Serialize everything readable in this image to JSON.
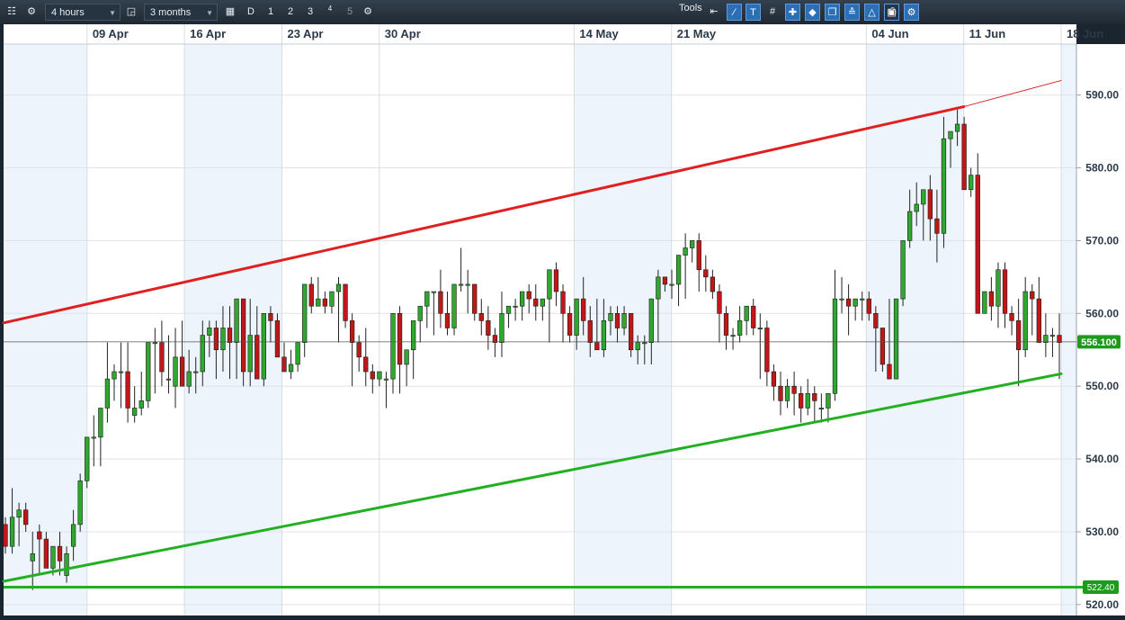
{
  "toolbar": {
    "interval": "4 hours",
    "period": "3 months",
    "period_buttons": [
      "D",
      "1",
      "2",
      "3",
      "4",
      "5"
    ],
    "tools_label": "Tools",
    "icons": [
      "menu-icon",
      "settings-icon",
      "lock-icon",
      "calendar-icon",
      "chart-settings-icon",
      "arrow-back-icon",
      "line-tool-icon",
      "text-tool-icon",
      "grid-icon",
      "crosshair-icon",
      "marker-icon",
      "copy-icon",
      "indicator-icon",
      "shape-icon",
      "fullscreen-icon",
      "print-icon",
      "settings-tools-icon"
    ]
  },
  "chart_data": {
    "type": "candlestick",
    "x_tick_labels": [
      "09 Apr",
      "16 Apr",
      "23 Apr",
      "30 Apr",
      "14 May",
      "21 May",
      "04 Jun",
      "11 Jun",
      "18 Jun"
    ],
    "y_tick_labels": [
      "590.00",
      "580.00",
      "570.00",
      "560.00",
      "550.00",
      "540.00",
      "530.00",
      "520.00"
    ],
    "ylim": [
      518.5,
      597
    ],
    "current_price_label": "556.100",
    "support_label": "522.40",
    "current_price": 556.1,
    "support_level": 522.4,
    "trendlines": [
      {
        "name": "resistance",
        "color": "#e02020",
        "from": {
          "date": "2018-04-03",
          "value": 558.7
        },
        "to": {
          "date": "2018-06-11",
          "value": 588.4
        }
      },
      {
        "name": "resistance-extension",
        "color": "#e02020",
        "from": {
          "date": "2018-06-11",
          "value": 588.4
        },
        "to": {
          "date": "2018-06-18",
          "value": 592.0
        }
      },
      {
        "name": "support",
        "color": "#22b022",
        "from": {
          "date": "2018-04-03",
          "value": 523.2
        },
        "to": {
          "date": "2018-06-18",
          "value": 551.7
        }
      }
    ],
    "up_color": "#2fa82f",
    "down_color": "#c01818",
    "candles": [
      [
        531,
        532,
        527,
        528
      ],
      [
        528,
        536,
        527,
        532
      ],
      [
        532,
        534,
        528,
        533
      ],
      [
        533,
        534,
        530,
        531
      ],
      [
        526,
        530,
        522,
        527
      ],
      [
        530,
        531,
        524,
        529
      ],
      [
        529,
        530,
        525,
        525
      ],
      [
        525,
        527,
        524,
        528
      ],
      [
        528,
        530,
        524,
        526
      ],
      [
        524,
        528,
        523,
        527
      ],
      [
        528,
        533,
        526,
        531
      ],
      [
        531,
        538,
        530,
        537
      ],
      [
        537,
        543,
        536,
        543
      ],
      [
        543,
        546,
        539,
        543
      ],
      [
        543,
        544,
        539,
        547
      ],
      [
        547,
        556,
        545,
        551
      ],
      [
        551,
        553,
        548,
        552
      ],
      [
        552,
        556,
        547,
        552
      ],
      [
        552,
        556,
        545,
        547
      ],
      [
        546,
        550,
        545,
        547
      ],
      [
        547,
        552,
        546,
        548
      ],
      [
        548,
        551,
        547,
        556
      ],
      [
        556,
        558,
        549,
        556
      ],
      [
        556,
        559,
        550,
        552
      ],
      [
        551,
        557,
        549,
        551
      ],
      [
        550,
        558,
        547,
        554
      ],
      [
        554,
        559,
        550,
        550
      ],
      [
        550,
        555,
        549,
        552
      ],
      [
        552,
        554,
        549,
        552
      ],
      [
        552,
        559,
        550,
        557
      ],
      [
        557,
        559,
        554,
        558
      ],
      [
        558,
        559,
        551,
        555
      ],
      [
        555,
        561,
        552,
        558
      ],
      [
        558,
        561,
        551,
        556
      ],
      [
        556,
        562,
        551,
        562
      ],
      [
        562,
        562,
        550,
        552
      ],
      [
        552,
        562,
        550,
        557
      ],
      [
        557,
        561,
        551,
        551
      ],
      [
        551,
        560,
        550,
        560
      ],
      [
        560,
        561,
        556,
        559
      ],
      [
        559,
        560,
        554,
        554
      ],
      [
        554,
        556,
        552,
        552
      ],
      [
        552,
        555,
        551,
        553
      ],
      [
        553,
        555,
        552,
        556
      ],
      [
        556,
        564,
        554,
        564
      ],
      [
        564,
        565,
        560,
        561
      ],
      [
        561,
        565,
        561,
        562
      ],
      [
        562,
        563,
        560,
        561
      ],
      [
        561,
        562,
        560,
        563
      ],
      [
        563,
        565,
        556,
        564
      ],
      [
        564,
        564,
        558,
        559
      ],
      [
        559,
        560,
        550,
        556
      ],
      [
        556,
        557,
        552,
        554
      ],
      [
        554,
        558,
        550,
        552
      ],
      [
        552,
        553,
        549,
        551
      ],
      [
        551,
        552,
        550,
        552
      ],
      [
        551,
        552,
        547,
        551
      ],
      [
        551,
        556,
        549,
        560
      ],
      [
        560,
        561,
        549,
        553
      ],
      [
        553,
        554,
        550,
        555
      ],
      [
        555,
        556,
        551,
        559
      ],
      [
        559,
        560,
        556,
        561
      ],
      [
        561,
        563,
        558,
        563
      ],
      [
        563,
        563,
        557,
        563
      ],
      [
        563,
        566,
        558,
        560
      ],
      [
        560,
        563,
        557,
        558
      ],
      [
        558,
        563,
        557,
        564
      ],
      [
        564,
        569,
        563,
        564
      ],
      [
        564,
        566,
        560,
        564
      ],
      [
        564,
        564,
        559,
        560
      ],
      [
        560,
        562,
        557,
        559
      ],
      [
        559,
        561,
        555,
        557
      ],
      [
        557,
        558,
        554,
        556
      ],
      [
        556,
        563,
        554,
        560
      ],
      [
        560,
        561,
        558,
        561
      ],
      [
        561,
        562,
        559,
        561
      ],
      [
        561,
        563,
        559,
        563
      ],
      [
        563,
        564,
        560,
        562
      ],
      [
        562,
        564,
        559,
        561
      ],
      [
        561,
        562,
        559,
        562
      ],
      [
        562,
        564,
        556,
        566
      ],
      [
        566,
        567,
        561,
        563
      ],
      [
        563,
        564,
        556,
        560
      ],
      [
        560,
        561,
        556,
        557
      ],
      [
        557,
        561,
        555,
        562
      ],
      [
        562,
        565,
        557,
        559
      ],
      [
        559,
        561,
        554,
        556
      ],
      [
        556,
        562,
        555,
        555
      ],
      [
        555,
        562,
        554,
        559
      ],
      [
        559,
        561,
        557,
        560
      ],
      [
        560,
        561,
        556,
        558
      ],
      [
        558,
        561,
        557,
        560
      ],
      [
        560,
        560,
        554,
        555
      ],
      [
        555,
        557,
        553,
        556
      ],
      [
        556,
        557,
        553,
        556
      ],
      [
        556,
        558,
        553,
        562
      ],
      [
        562,
        566,
        556,
        565
      ],
      [
        565,
        565,
        563,
        564
      ],
      [
        564,
        566,
        562,
        564
      ],
      [
        564,
        568,
        561,
        568
      ],
      [
        568,
        571,
        562,
        569
      ],
      [
        569,
        570,
        567,
        570
      ],
      [
        570,
        571,
        563,
        566
      ],
      [
        566,
        568,
        563,
        565
      ],
      [
        565,
        566,
        562,
        563
      ],
      [
        563,
        564,
        556,
        560
      ],
      [
        560,
        561,
        555,
        557
      ],
      [
        557,
        558,
        555,
        557
      ],
      [
        557,
        561,
        556,
        559
      ],
      [
        559,
        561,
        557,
        561
      ],
      [
        561,
        562,
        557,
        558
      ],
      [
        558,
        560,
        551,
        558
      ],
      [
        558,
        559,
        550,
        552
      ],
      [
        552,
        553,
        548,
        550
      ],
      [
        550,
        552,
        546,
        548
      ],
      [
        548,
        551,
        547,
        550
      ],
      [
        550,
        552,
        546,
        549
      ],
      [
        549,
        550,
        545,
        547
      ],
      [
        547,
        551,
        546,
        549
      ],
      [
        549,
        550,
        545,
        548
      ],
      [
        547,
        549,
        545,
        547
      ],
      [
        547,
        549,
        545,
        549
      ],
      [
        549,
        566,
        548,
        562
      ],
      [
        562,
        565,
        560,
        562
      ],
      [
        562,
        564,
        557,
        561
      ],
      [
        561,
        562,
        559,
        562
      ],
      [
        562,
        563,
        559,
        562
      ],
      [
        562,
        563,
        559,
        560
      ],
      [
        560,
        561,
        552,
        558
      ],
      [
        558,
        558,
        552,
        553
      ],
      [
        553,
        562,
        551,
        551
      ],
      [
        551,
        562,
        551,
        562
      ],
      [
        562,
        568,
        561,
        570
      ],
      [
        570,
        577,
        569,
        574
      ],
      [
        574,
        578,
        572,
        575
      ],
      [
        575,
        576,
        570,
        577
      ],
      [
        577,
        579,
        570,
        573
      ],
      [
        573,
        577,
        567,
        571
      ],
      [
        571,
        587,
        569,
        584
      ],
      [
        584,
        585,
        580,
        585
      ],
      [
        585,
        588,
        583,
        586
      ],
      [
        586,
        587,
        577,
        577
      ],
      [
        577,
        580,
        576,
        579
      ],
      [
        579,
        582,
        561,
        560
      ],
      [
        560,
        563,
        560,
        563
      ],
      [
        563,
        565,
        559,
        561
      ],
      [
        561,
        567,
        558,
        566
      ],
      [
        566,
        567,
        558,
        560
      ],
      [
        560,
        561,
        557,
        559
      ],
      [
        559,
        562,
        550,
        555
      ],
      [
        555,
        565,
        554,
        563
      ],
      [
        563,
        564,
        557,
        562
      ],
      [
        562,
        565,
        557,
        556
      ],
      [
        556,
        560,
        554,
        557
      ],
      [
        557,
        558,
        554,
        557
      ],
      [
        557,
        560,
        551,
        556
      ]
    ]
  }
}
